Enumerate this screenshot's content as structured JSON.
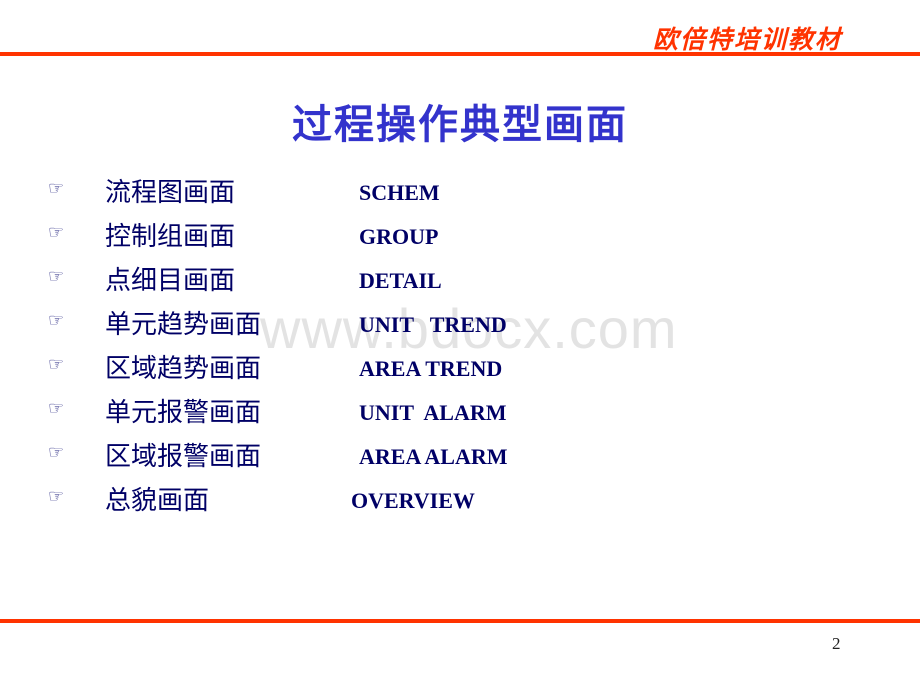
{
  "header": {
    "brand": "欧倍特培训教材"
  },
  "title": "过程操作典型画面",
  "watermark": "www.bdocx.com",
  "items": [
    {
      "bullet_icon": "pointing-hand-icon",
      "bullet": "☞",
      "chinese": "流程图画面",
      "english": "SCHEM"
    },
    {
      "bullet_icon": "pointing-hand-icon",
      "bullet": "☞",
      "chinese": "控制组画面",
      "english": "GROUP"
    },
    {
      "bullet_icon": "pointing-hand-icon",
      "bullet": "☞",
      "chinese": "点细目画面",
      "english": "DETAIL"
    },
    {
      "bullet_icon": "pointing-hand-icon",
      "bullet": "☞",
      "chinese": "单元趋势画面",
      "english": "UNIT   TREND"
    },
    {
      "bullet_icon": "pointing-hand-icon",
      "bullet": "☞",
      "chinese": "区域趋势画面",
      "english": "AREA TREND"
    },
    {
      "bullet_icon": "pointing-hand-icon",
      "bullet": "☞",
      "chinese": "单元报警画面",
      "english": "UNIT  ALARM"
    },
    {
      "bullet_icon": "pointing-hand-icon",
      "bullet": "☞",
      "chinese": "区域报警画面",
      "english": "AREA ALARM"
    },
    {
      "bullet_icon": "pointing-hand-icon",
      "bullet": "☞",
      "chinese": "总貌画面",
      "english": "OVERVIEW"
    }
  ],
  "footer": {
    "page_number": "2"
  },
  "colors": {
    "accent_rule": "#ff3300",
    "title": "#3333cc",
    "body_text": "#000066"
  }
}
